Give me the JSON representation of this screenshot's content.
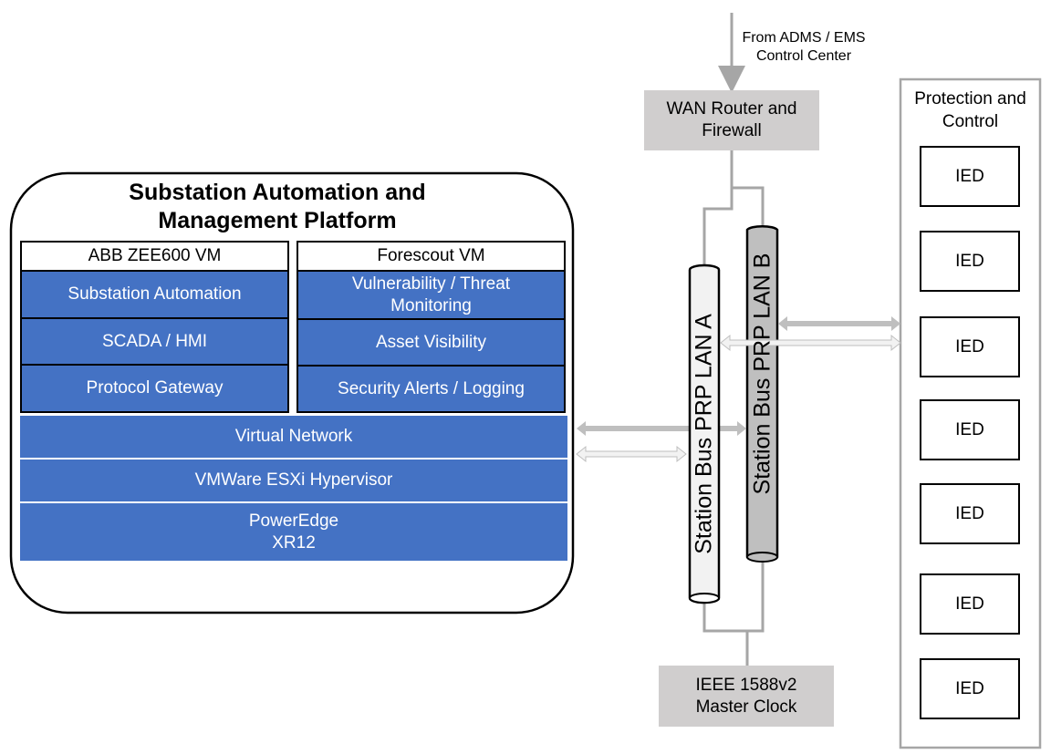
{
  "colors": {
    "platform_blue": "#4472c4",
    "gray_box": "#d0cece",
    "lan_a_fill": "#f2f2f2",
    "lan_b_fill": "#bfbfbf",
    "connector": "#a6a6a6"
  },
  "upstream": {
    "label_line1": "From ADMS / EMS",
    "label_line2": "Control Center"
  },
  "wan": {
    "line1": "WAN Router and",
    "line2": "Firewall"
  },
  "clock": {
    "line1": "IEEE 1588v2",
    "line2": "Master Clock"
  },
  "lan_a": {
    "label": "Station Bus PRP LAN A"
  },
  "lan_b": {
    "label": "Station Bus PRP LAN B"
  },
  "protection": {
    "title_line1": "Protection and",
    "title_line2": "Control",
    "ieds": [
      "IED",
      "IED",
      "IED",
      "IED",
      "IED",
      "IED",
      "IED"
    ]
  },
  "platform": {
    "title_line1": "Substation Automation and",
    "title_line2": "Management Platform",
    "vm1": {
      "header": "ABB ZEE600 VM",
      "items": [
        "Substation Automation",
        "SCADA / HMI",
        "Protocol Gateway"
      ]
    },
    "vm2": {
      "header": "Forescout VM",
      "items": [
        "Vulnerability / Threat Monitoring",
        "Asset Visibility",
        "Security Alerts / Logging"
      ]
    },
    "virtual_network": "Virtual Network",
    "hypervisor": "VMWare ESXi Hypervisor",
    "hardware_line1": "PowerEdge",
    "hardware_line2": "XR12"
  }
}
